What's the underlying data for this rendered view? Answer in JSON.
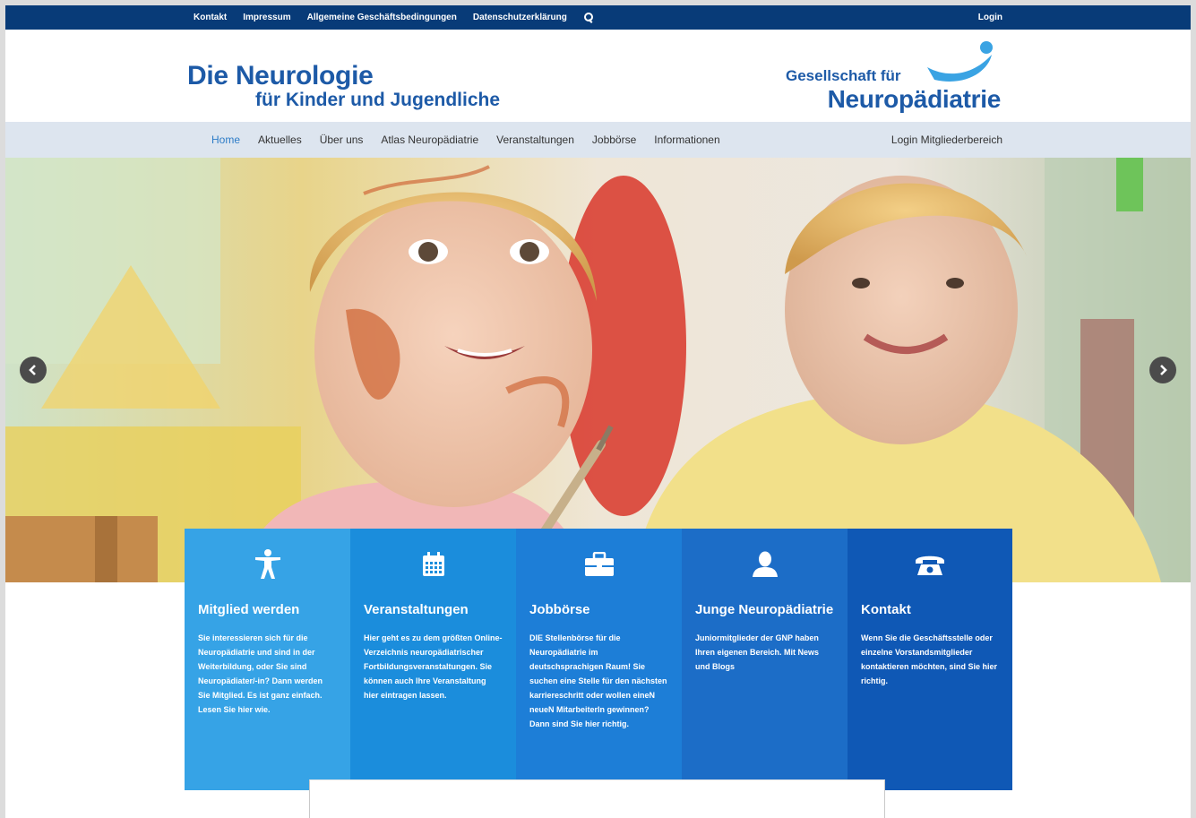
{
  "topbar": {
    "links": [
      "Kontakt",
      "Impressum",
      "Allgemeine Geschäftsbedingungen",
      "Datenschutzerklärung"
    ],
    "login": "Login"
  },
  "brand": {
    "line1": "Die Neurologie",
    "line2": "für Kinder und Jugendliche",
    "org_line1": "Gesellschaft für",
    "org_line2": "Neuropädiatrie"
  },
  "nav": {
    "items": [
      "Home",
      "Aktuelles",
      "Über uns",
      "Atlas Neuropädiatrie",
      "Veranstaltungen",
      "Jobbörse",
      "Informationen"
    ],
    "active": "Home",
    "member_login": "Login Mitgliederbereich"
  },
  "features": [
    {
      "icon": "person-icon",
      "title": "Mitglied werden",
      "text": "Sie interessieren sich für die Neuropädiatrie und sind in der Weiterbildung, oder Sie sind Neuropädiater/-in? Dann werden Sie Mitglied. Es ist ganz einfach. Lesen Sie hier wie."
    },
    {
      "icon": "calendar-icon",
      "title": "Veranstaltungen",
      "text": "Hier geht es zu dem größten Online-Verzeichnis neuropädiatrischer Fortbildungsveranstaltungen. Sie können auch Ihre Veranstaltung hier eintragen lassen."
    },
    {
      "icon": "briefcase-icon",
      "title": "Jobbörse",
      "text": "DIE Stellenbörse für die Neuropädiatrie im deutschsprachigen Raum! Sie suchen eine Stelle für den nächsten karriereschritt oder wollen eineN neueN MitarbeiterIn gewinnen? Dann sind Sie hier richtig."
    },
    {
      "icon": "user-icon",
      "title": "Junge Neuropädiatrie",
      "text": "Juniormitglieder der GNP haben Ihren eigenen Bereich. Mit News und Blogs"
    },
    {
      "icon": "phone-icon",
      "title": "Kontakt",
      "text": "Wenn Sie die Geschäftsstelle oder einzelne Vorstandsmitglieder kontaktieren möchten, sind Sie hier richtig."
    }
  ],
  "colors": {
    "topbar": "#083b78",
    "brand": "#1d5aa7",
    "nav_bg": "#dde5ef",
    "active_nav": "#2d7cc7",
    "box1": "#36a3e6",
    "box2": "#1b8ddc",
    "box3": "#1d7ed7",
    "box4": "#1c6dc7",
    "box5": "#0f58b5"
  }
}
